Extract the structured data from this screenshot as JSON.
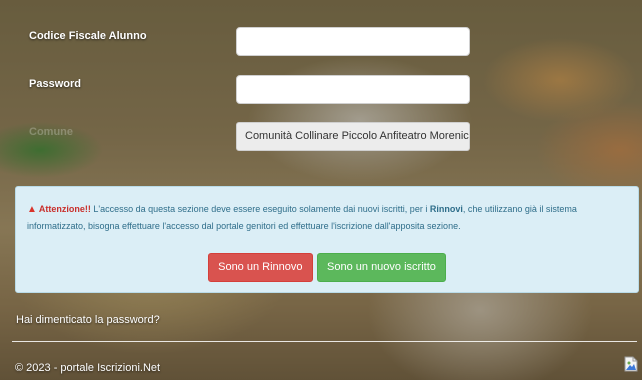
{
  "form": {
    "codice_label": "Codice Fiscale Alunno",
    "codice_value": "",
    "password_label": "Password",
    "password_value": "",
    "comune_label": "Comune",
    "comune_selected": "Comunità Collinare Piccolo Anfiteatro Morenico"
  },
  "alert": {
    "heading": "Attenzione!!",
    "text_before": " L'accesso da questa sezione deve essere eseguito solamente dai nuovi iscritti, per i ",
    "highlight": "Rinnovi",
    "text_after": ", che utilizzano già il sistema informatizzato, bisogna effettuare l'accesso dal portale genitori ed effettuare l'iscrizione dall'apposita sezione.",
    "icon": "warning-triangle-icon",
    "colors": {
      "icon": "#d9342b",
      "text": "#2f6e8a",
      "background": "#dbeef6"
    }
  },
  "buttons": {
    "rinnovo": "Sono un Rinnovo",
    "nuovo": "Sono un nuovo iscritto",
    "colors": {
      "rinnovo": "#d9534f",
      "nuovo": "#5cb85c"
    }
  },
  "links": {
    "forgot_password": "Hai dimenticato la password?"
  },
  "footer": {
    "text": "© 2023 - portale Iscrizioni.Net",
    "image_icon": "broken-image-icon"
  }
}
